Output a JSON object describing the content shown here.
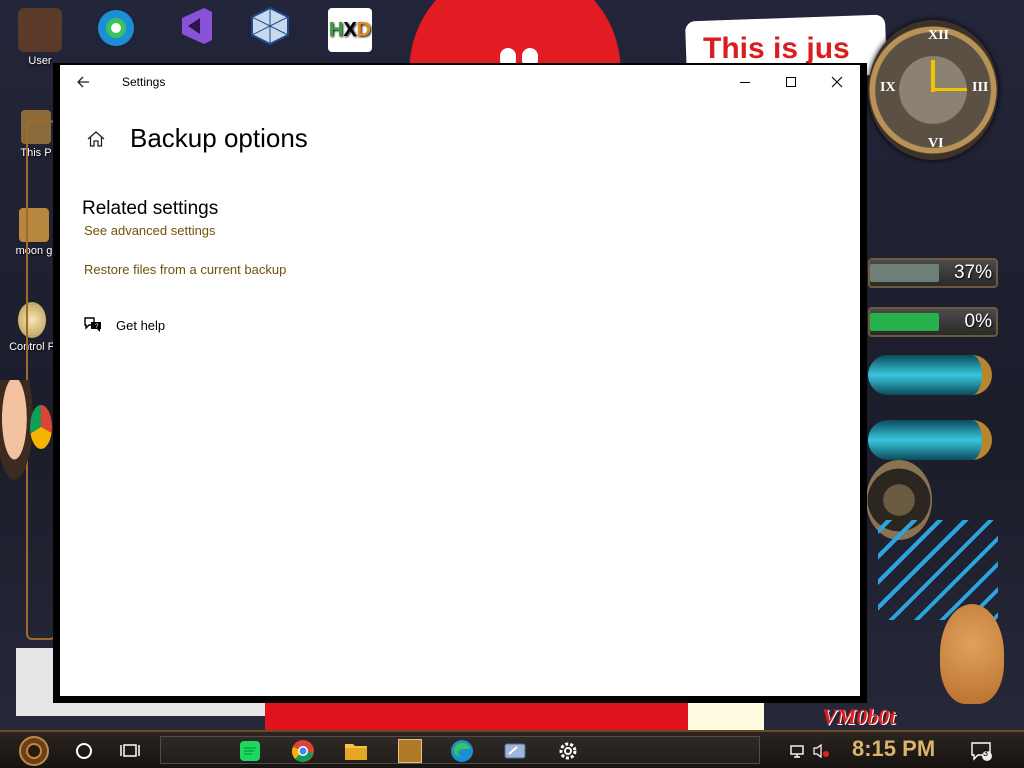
{
  "desktop": {
    "icons": [
      {
        "name": "user-folder",
        "label": "User"
      },
      {
        "name": "edge",
        "label": ""
      },
      {
        "name": "visual-studio",
        "label": ""
      },
      {
        "name": "virtualbox",
        "label": ""
      },
      {
        "name": "hxd",
        "label": ""
      },
      {
        "name": "this-pc",
        "label": "This P"
      },
      {
        "name": "moon-gift",
        "label": "moon g"
      },
      {
        "name": "control-panel",
        "label": "Control P"
      }
    ],
    "note_text": "This is jus",
    "gauges": [
      {
        "label": "37%",
        "value": 37,
        "color": "#6e7f77"
      },
      {
        "label": "0%",
        "value": 0,
        "color": "#27b14b"
      }
    ],
    "vmobot_text": "VM0b0t"
  },
  "window": {
    "title": "Settings",
    "page_title": "Backup options",
    "section_title": "Related settings",
    "links": {
      "advanced": "See advanced settings",
      "restore": "Restore files from a current backup"
    },
    "help_label": "Get help"
  },
  "taskbar": {
    "time": "8:15 PM",
    "notification_count": "3",
    "pinned": [
      {
        "name": "spotify-icon"
      },
      {
        "name": "chrome-icon"
      },
      {
        "name": "file-explorer-icon"
      },
      {
        "name": "app-icon"
      },
      {
        "name": "edge-icon"
      },
      {
        "name": "remote-icon"
      },
      {
        "name": "settings-icon"
      }
    ]
  },
  "colors": {
    "link": "#73510b",
    "wallpaper": "#1c1d2b",
    "accent_red": "#e31b23"
  }
}
